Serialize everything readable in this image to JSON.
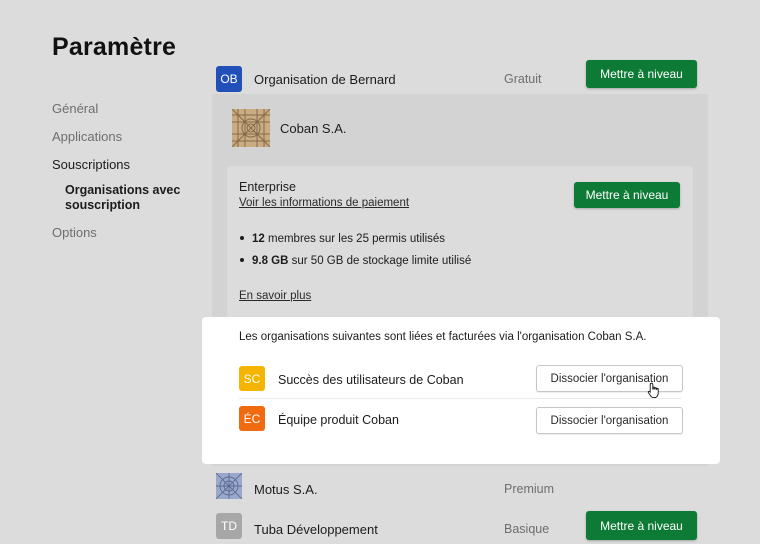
{
  "page": {
    "title": "Paramètre"
  },
  "nav": {
    "items": [
      {
        "label": "Général"
      },
      {
        "label": "Applications"
      },
      {
        "label": "Souscriptions"
      },
      {
        "label": "Organisations avec souscription"
      },
      {
        "label": "Options"
      }
    ]
  },
  "orgs": {
    "bernard": {
      "initials": "OB",
      "name": "Organisation de Bernard",
      "plan": "Gratuit",
      "action": "Mettre à niveau"
    },
    "coban": {
      "name": "Coban S.A.",
      "plan_name": "Enterprise",
      "payment_link": "Voir les informations de paiement",
      "upgrade": "Mettre à niveau",
      "usage": [
        {
          "strong": "12",
          "text": " membres sur les 25 permis utilisés"
        },
        {
          "strong": "9.8 GB",
          "text": " sur 50 GB de stockage limite utilisé"
        }
      ],
      "learn_more": "En savoir plus",
      "linked_intro": "Les organisations suivantes sont liées et facturées via l'organisation Coban S.A.",
      "linked": [
        {
          "initials": "SC",
          "name": "Succès des utilisateurs de Coban",
          "action": "Dissocier l'organisation",
          "color": "#f5b400"
        },
        {
          "initials": "ÉC",
          "name": "Équipe produit Coban",
          "action": "Dissocier l'organisation",
          "color": "#f06a0f"
        }
      ]
    },
    "motus": {
      "name": "Motus S.A.",
      "plan": "Premium"
    },
    "tuba": {
      "initials": "TD",
      "name": "Tuba Développement",
      "plan": "Basique",
      "action": "Mettre à niveau"
    }
  },
  "colors": {
    "accent_green": "#0d7a35",
    "bernard_avatar": "#2050b8",
    "tuba_avatar": "#a7a7a7"
  }
}
